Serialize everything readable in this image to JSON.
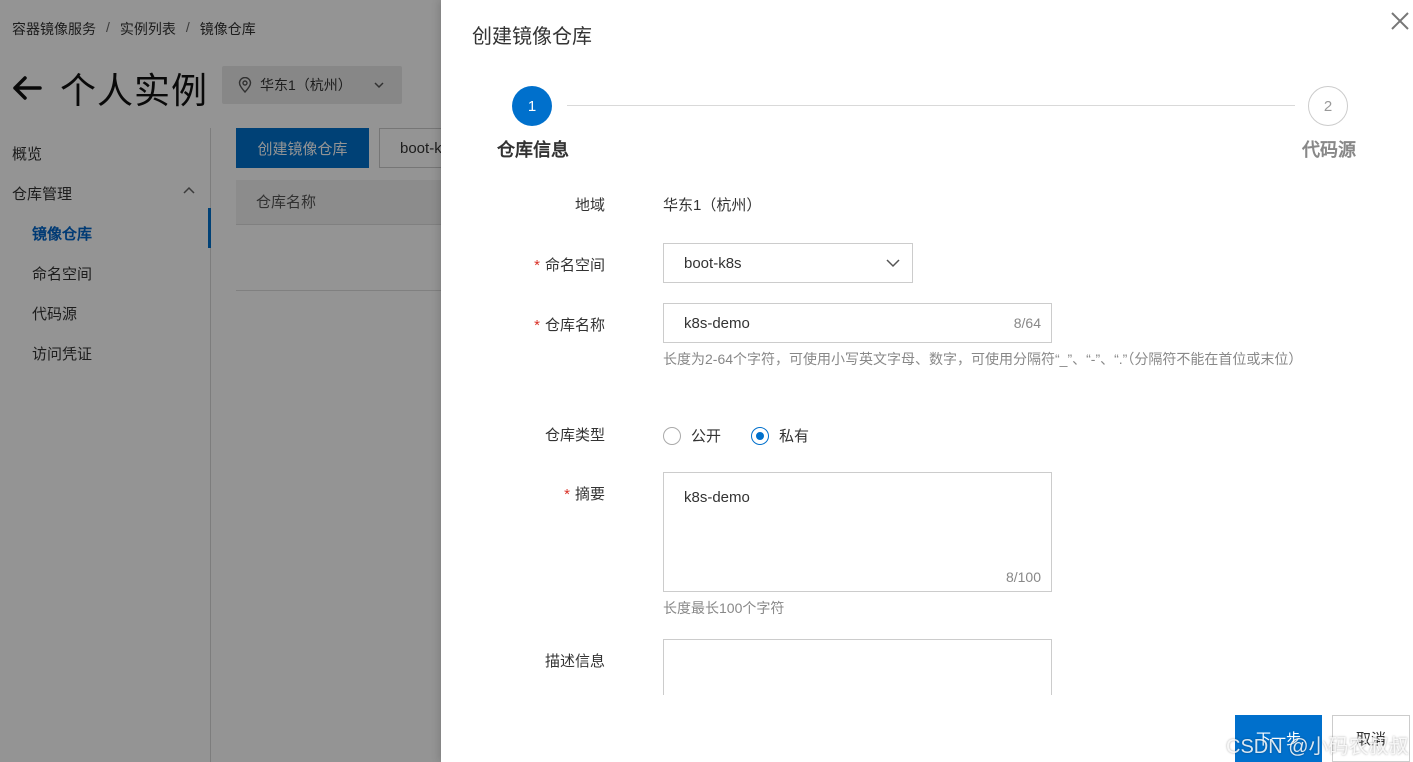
{
  "background": {
    "breadcrumb": [
      "容器镜像服务",
      "实例列表",
      "镜像仓库"
    ],
    "breadcrumb_sep": "/",
    "page_title": "个人实例",
    "region": "华东1（杭州）",
    "sidebar": {
      "items": [
        {
          "label": "概览"
        },
        {
          "label": "仓库管理"
        },
        {
          "label": "镜像仓库"
        },
        {
          "label": "命名空间"
        },
        {
          "label": "代码源"
        },
        {
          "label": "访问凭证"
        }
      ]
    },
    "create_repo_button": "创建镜像仓库",
    "namespace_filter": "boot-k",
    "table_col_repo_name": "仓库名称"
  },
  "drawer": {
    "title": "创建镜像仓库",
    "steps": [
      {
        "number": "1",
        "label": "仓库信息"
      },
      {
        "number": "2",
        "label": "代码源"
      }
    ],
    "fields": {
      "region_label": "地域",
      "region_value": "华东1（杭州）",
      "required_mark": "*",
      "namespace_label": "命名空间",
      "namespace_value": "boot-k8s",
      "repo_name_label": "仓库名称",
      "repo_name_value": "k8s-demo",
      "repo_name_counter": "8/64",
      "repo_name_help": "长度为2-64个字符，可使用小写英文字母、数字，可使用分隔符“_”、“-”、“.”（分隔符不能在首位或末位）",
      "repo_type_label": "仓库类型",
      "repo_type_options": [
        "公开",
        "私有"
      ],
      "summary_label": "摘要",
      "summary_value": "k8s-demo",
      "summary_counter": "8/100",
      "summary_help": "长度最长100个字符",
      "description_label": "描述信息"
    },
    "next_button": "下一步",
    "cancel_button": "取消"
  },
  "watermark": "CSDN @小码农叔叔",
  "colors": {
    "primary": "#0070cc",
    "required": "#d93026",
    "mask": "rgba(0,0,0,0.42)"
  }
}
